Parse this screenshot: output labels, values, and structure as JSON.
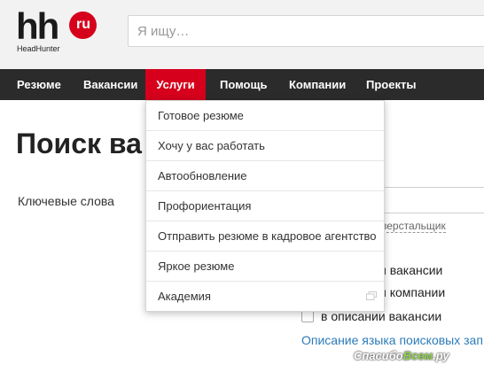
{
  "header": {
    "logo": {
      "main": "hh",
      "badge": "ru",
      "sub": "HeadHunter"
    },
    "search": {
      "placeholder": "Я ищу…"
    }
  },
  "nav": {
    "items": [
      {
        "label": "Резюме"
      },
      {
        "label": "Вакансии"
      },
      {
        "label": "Услуги",
        "active": true
      },
      {
        "label": "Помощь"
      },
      {
        "label": "Компании"
      },
      {
        "label": "Проекты"
      }
    ]
  },
  "main": {
    "title": "Поиск ва",
    "keywords_label": "Ключевые слова",
    "hint": "-верстальщик",
    "options": [
      "и вакансии",
      "и компании",
      "в описании вакансии"
    ],
    "lang_link": "Описание языка поисковых зап"
  },
  "dropdown": {
    "items": [
      {
        "label": "Готовое резюме"
      },
      {
        "label": "Хочу у вас работать"
      },
      {
        "label": "Автообновление"
      },
      {
        "label": "Профориентация"
      },
      {
        "label": "Отправить резюме в кадровое агентство"
      },
      {
        "label": "Яркое резюме"
      },
      {
        "label": "Академия",
        "icon": "external-link-icon"
      }
    ]
  },
  "watermark": {
    "part1": "Спасибо",
    "part2": "Всем",
    "part3": ".ру"
  },
  "colors": {
    "brand": "#d6001c",
    "nav_bg": "#2b2b2b",
    "link": "#2b7bb9"
  }
}
